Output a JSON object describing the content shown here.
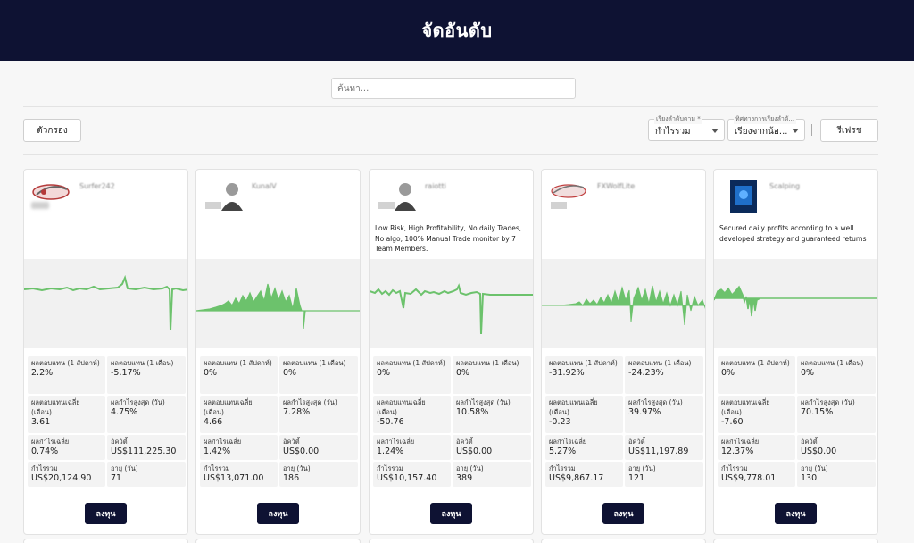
{
  "header": {
    "title": "จัดอันดับ"
  },
  "search": {
    "placeholder": "ค้นหา..."
  },
  "toolbar": {
    "filter_label": "ตัวกรอง",
    "sort_by": {
      "label": "เรียงลำดับตาม *",
      "value": "กำไรรวม"
    },
    "sort_dir": {
      "label": "ทิศทางการเรียงลำดั...",
      "value": "เรียงจากน้อ..."
    },
    "refresh_label": "รีเฟรช"
  },
  "invest_label": "ลงทุน",
  "line_color": "#6cc26c",
  "cards": [
    {
      "name": "Surfer242",
      "description": "",
      "stats": [
        {
          "label": "ผลตอบแทน (1 สัปดาห์)",
          "value": "2.2%"
        },
        {
          "label": "ผลตอบแทน (1 เดือน)",
          "value": "-5.17%"
        },
        {
          "label": "ผลตอบแทนเฉลี่ย (เดือน)",
          "value": "3.61"
        },
        {
          "label": "ผลกำไรสูงสุด (วัน)",
          "value": "4.75%"
        },
        {
          "label": "ผลกำไรเฉลี่ย",
          "value": "0.74%"
        },
        {
          "label": "อิควิตี้",
          "value": "US$111,225.30"
        },
        {
          "label": "กำไรรวม",
          "value": "US$20,124.90"
        },
        {
          "label": "อายุ (วัน)",
          "value": "71"
        }
      ]
    },
    {
      "name": "KunalV",
      "description": "",
      "stats": [
        {
          "label": "ผลตอบแทน (1 สัปดาห์)",
          "value": "0%"
        },
        {
          "label": "ผลตอบแทน (1 เดือน)",
          "value": "0%"
        },
        {
          "label": "ผลตอบแทนเฉลี่ย (เดือน)",
          "value": "4.66"
        },
        {
          "label": "ผลกำไรสูงสุด (วัน)",
          "value": "7.28%"
        },
        {
          "label": "ผลกำไรเฉลี่ย",
          "value": "1.42%"
        },
        {
          "label": "อิควิตี้",
          "value": "US$0.00"
        },
        {
          "label": "กำไรรวม",
          "value": "US$13,071.00"
        },
        {
          "label": "อายุ (วัน)",
          "value": "186"
        }
      ]
    },
    {
      "name": "raiotti",
      "description": "Low Risk, High Profitability, No daily Trades, No algo, 100% Manual Trade monitor by 7 Team Members.",
      "stats": [
        {
          "label": "ผลตอบแทน (1 สัปดาห์)",
          "value": "0%"
        },
        {
          "label": "ผลตอบแทน (1 เดือน)",
          "value": "0%"
        },
        {
          "label": "ผลตอบแทนเฉลี่ย (เดือน)",
          "value": "-50.76"
        },
        {
          "label": "ผลกำไรสูงสุด (วัน)",
          "value": "10.58%"
        },
        {
          "label": "ผลกำไรเฉลี่ย",
          "value": "1.24%"
        },
        {
          "label": "อิควิตี้",
          "value": "US$0.00"
        },
        {
          "label": "กำไรรวม",
          "value": "US$10,157.40"
        },
        {
          "label": "อายุ (วัน)",
          "value": "389"
        }
      ]
    },
    {
      "name": "FXWolfLite",
      "description": "",
      "stats": [
        {
          "label": "ผลตอบแทน (1 สัปดาห์)",
          "value": "-31.92%"
        },
        {
          "label": "ผลตอบแทน (1 เดือน)",
          "value": "-24.23%"
        },
        {
          "label": "ผลตอบแทนเฉลี่ย (เดือน)",
          "value": "-0.23"
        },
        {
          "label": "ผลกำไรสูงสุด (วัน)",
          "value": "39.97%"
        },
        {
          "label": "ผลกำไรเฉลี่ย",
          "value": "5.27%"
        },
        {
          "label": "อิควิตี้",
          "value": "US$11,197.89"
        },
        {
          "label": "กำไรรวม",
          "value": "US$9,867.17"
        },
        {
          "label": "อายุ (วัน)",
          "value": "121"
        }
      ]
    },
    {
      "name": "Scalping",
      "description": "Secured daily profits according to a well developed strategy and guaranteed returns",
      "stats": [
        {
          "label": "ผลตอบแทน (1 สัปดาห์)",
          "value": "0%"
        },
        {
          "label": "ผลตอบแทน (1 เดือน)",
          "value": "0%"
        },
        {
          "label": "ผลตอบแทนเฉลี่ย (เดือน)",
          "value": "-7.60"
        },
        {
          "label": "ผลกำไรสูงสุด (วัน)",
          "value": "70.15%"
        },
        {
          "label": "ผลกำไรเฉลี่ย",
          "value": "12.37%"
        },
        {
          "label": "อิควิตี้",
          "value": "US$0.00"
        },
        {
          "label": "กำไรรวม",
          "value": "US$9,778.01"
        },
        {
          "label": "อายุ (วัน)",
          "value": "130"
        }
      ]
    }
  ]
}
